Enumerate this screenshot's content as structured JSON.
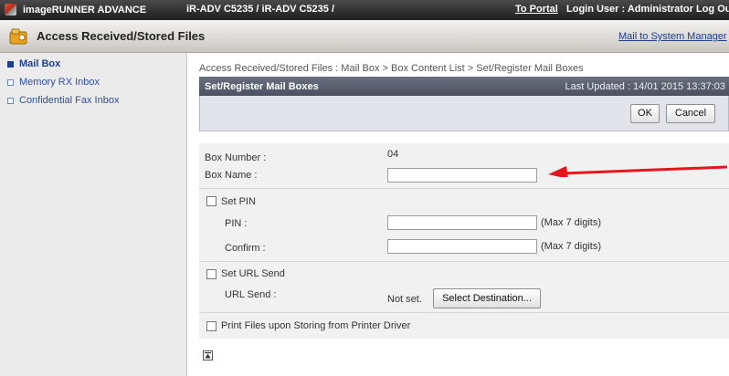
{
  "topbar": {
    "brand": "imageRUNNER ADVANCE",
    "device": "iR-ADV C5235 / iR-ADV C5235 /",
    "portal_link": "To Portal",
    "user": "Login User : Administrator Log Out"
  },
  "titlebar": {
    "title": "Access Received/Stored Files",
    "mail_link": "Mail to System Manager"
  },
  "sidebar": {
    "items": [
      {
        "label": "Mail Box",
        "active": true
      },
      {
        "label": "Memory RX Inbox",
        "active": false
      },
      {
        "label": "Confidential Fax Inbox",
        "active": false
      }
    ]
  },
  "breadcrumb": "Access Received/Stored Files : Mail Box > Box Content List > Set/Register Mail Boxes",
  "panel": {
    "title": "Set/Register Mail Boxes",
    "last_updated": "Last Updated : 14/01 2015 13:37:03",
    "ok_label": "OK",
    "cancel_label": "Cancel"
  },
  "form": {
    "box_number_label": "Box Number :",
    "box_number_value": "04",
    "box_name_label": "Box Name :",
    "box_name_value": "",
    "set_pin_label": "Set PIN",
    "pin_label": "PIN :",
    "pin_hint": "(Max 7 digits)",
    "confirm_label": "Confirm :",
    "confirm_hint": "(Max 7 digits)",
    "set_url_label": "Set URL Send",
    "url_send_label": "URL Send :",
    "url_send_value": "Not set.",
    "select_destination_label": "Select Destination...",
    "print_files_label": "Print Files upon Storing from Printer Driver"
  },
  "colors": {
    "accent_arrow": "#e8141c",
    "link": "#1f3f8f"
  }
}
